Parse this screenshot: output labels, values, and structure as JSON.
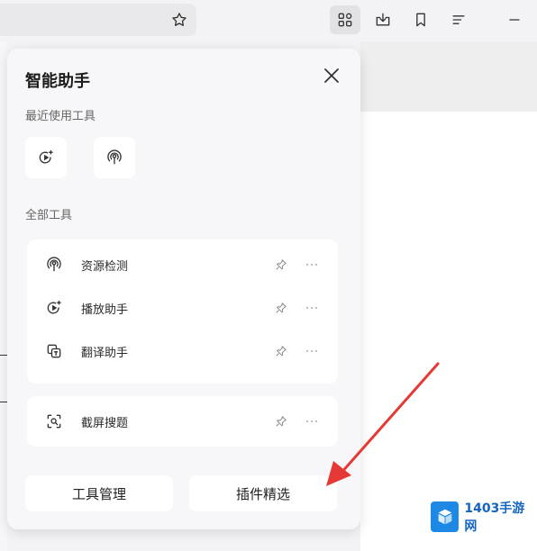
{
  "toolbar": {
    "icons": [
      "star-icon",
      "apps-grid-icon",
      "download-icon",
      "bookmark-icon",
      "menu-lines-icon",
      "minimize-icon"
    ]
  },
  "panel": {
    "title": "智能助手",
    "recent_label": "最近使用工具",
    "all_label": "全部工具",
    "recent_tools": [
      {
        "icon": "play-assistant-icon"
      },
      {
        "icon": "resource-detect-icon"
      }
    ],
    "tools": [
      {
        "name": "资源检测",
        "icon": "resource-detect-icon"
      },
      {
        "name": "播放助手",
        "icon": "play-assistant-icon"
      },
      {
        "name": "翻译助手",
        "icon": "translate-icon"
      },
      {
        "name": "截屏搜题",
        "icon": "screenshot-search-icon"
      }
    ],
    "buttons": {
      "manage": "工具管理",
      "plugins": "插件精选"
    }
  },
  "watermark": {
    "text": "1403手游网"
  },
  "colors": {
    "accent_arrow": "#e53935",
    "panel_bg": "#f7f7f9",
    "card_bg": "#ffffff",
    "watermark_blue": "#1e88e5"
  }
}
